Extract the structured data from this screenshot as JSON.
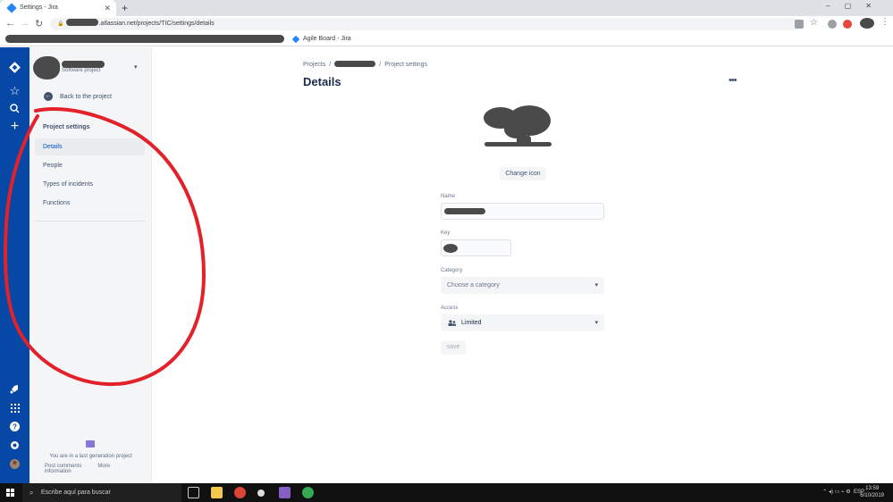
{
  "browser": {
    "tab_title": "Settings - Jira",
    "new_tab": "+",
    "url_prefix": "",
    "url_suffix": ".atlassian.net/projects/TIC/settings/details",
    "bookmark_label": "Agile Board - Jira"
  },
  "sidebar": {
    "project_type": "Software project",
    "back_label": "Back to the project",
    "heading": "Project settings",
    "items": [
      {
        "label": "Details",
        "active": true
      },
      {
        "label": "People"
      },
      {
        "label": "Types of incidents"
      },
      {
        "label": "Functions"
      }
    ],
    "legacy_text": "You are in a last generation project",
    "legacy_links": [
      "Post comments",
      "More information"
    ]
  },
  "main": {
    "breadcrumb": {
      "projects": "Projects",
      "separator": "/",
      "current": "Project settings"
    },
    "title": "Details",
    "more": "•••",
    "change_icon": "Change icon",
    "fields": {
      "name_label": "Name",
      "key_label": "Key",
      "category_label": "Category",
      "category_placeholder": "Choose a category",
      "access_label": "Access",
      "access_value": "Limited"
    },
    "save": "save"
  },
  "taskbar": {
    "search_placeholder": "Escribe aquí para buscar",
    "lang": "ESP",
    "time": "13:59",
    "date": "6/10/2019"
  },
  "colors": {
    "global_nav": "#0747a6",
    "accent": "#0052cc",
    "annotation": "#e3212b"
  },
  "icons": [
    "jira-logo-icon",
    "star-icon",
    "search-icon",
    "plus-icon",
    "rocket-icon",
    "apps-icon",
    "help-icon",
    "settings-icon",
    "user-avatar"
  ]
}
